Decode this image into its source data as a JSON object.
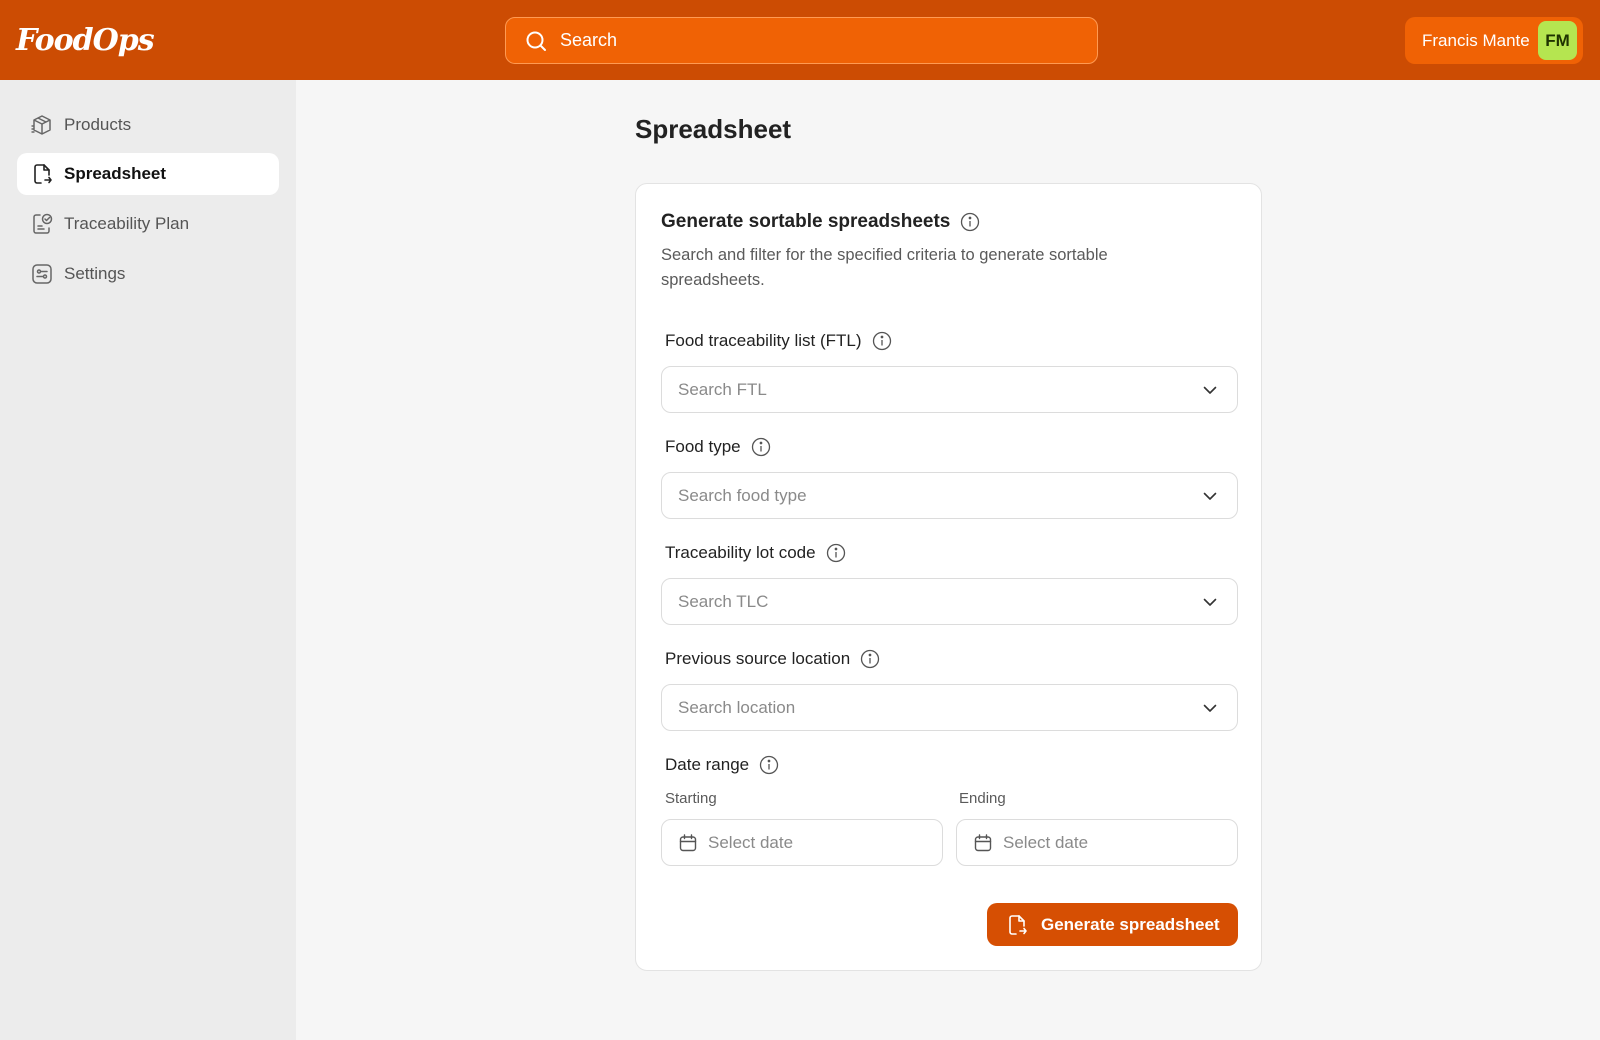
{
  "header": {
    "logo_text": "FoodOps",
    "search_placeholder": "Search",
    "user_name": "Francis Mante",
    "user_initials": "FM"
  },
  "sidebar": {
    "items": [
      {
        "label": "Products",
        "icon": "box-icon",
        "active": false
      },
      {
        "label": "Spreadsheet",
        "icon": "file-export-icon",
        "active": true
      },
      {
        "label": "Traceability Plan",
        "icon": "document-check-icon",
        "active": false
      },
      {
        "label": "Settings",
        "icon": "sliders-icon",
        "active": false
      }
    ]
  },
  "main": {
    "page_title": "Spreadsheet",
    "card": {
      "title": "Generate sortable spreadsheets",
      "description": "Search and filter for the specified criteria to generate sortable spreadsheets.",
      "fields": [
        {
          "label": "Food traceability list (FTL)",
          "placeholder": "Search FTL"
        },
        {
          "label": "Food type",
          "placeholder": "Search food type"
        },
        {
          "label": "Traceability lot code",
          "placeholder": "Search TLC"
        },
        {
          "label": "Previous source location",
          "placeholder": "Search location"
        }
      ],
      "date_range": {
        "label": "Date range",
        "start_label": "Starting",
        "end_label": "Ending",
        "start_placeholder": "Select date",
        "end_placeholder": "Select date"
      },
      "submit_label": "Generate spreadsheet"
    }
  },
  "colors": {
    "brand": "#cc4c03",
    "accent": "#f06205",
    "button": "#d64f03",
    "avatar": "#b5e550"
  }
}
